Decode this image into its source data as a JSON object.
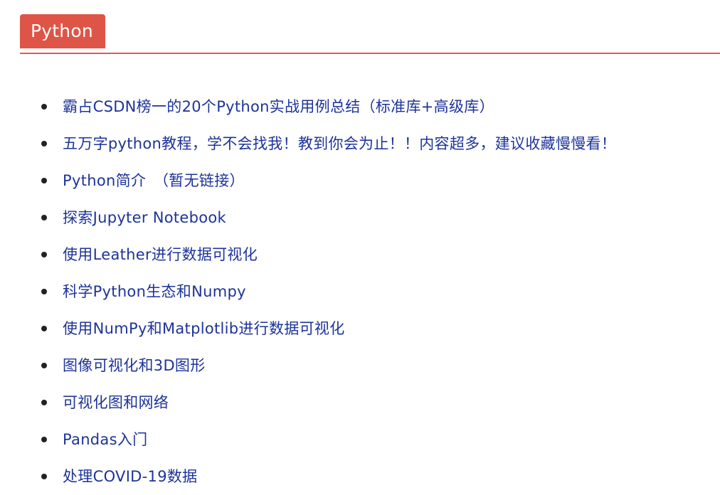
{
  "section": {
    "title": "Python",
    "colors": {
      "tag_background": "#de5547",
      "underline": "#e05a4f",
      "link": "#1d3399"
    }
  },
  "links": [
    {
      "label": "霸占CSDN榜一的20个Python实战用例总结（标准库+高级库）"
    },
    {
      "label": "五万字python教程，学不会找我！教到你会为止！！内容超多，建议收藏慢慢看！"
    },
    {
      "label": "Python简介　（暂无链接）"
    },
    {
      "label": "探索Jupyter Notebook"
    },
    {
      "label": "使用Leather进行数据可视化"
    },
    {
      "label": "科学Python生态和Numpy"
    },
    {
      "label": "使用NumPy和Matplotlib进行数据可视化"
    },
    {
      "label": "图像可视化和3D图形"
    },
    {
      "label": "可视化图和网络"
    },
    {
      "label": "Pandas入门"
    },
    {
      "label": "处理COVID-19数据"
    }
  ]
}
